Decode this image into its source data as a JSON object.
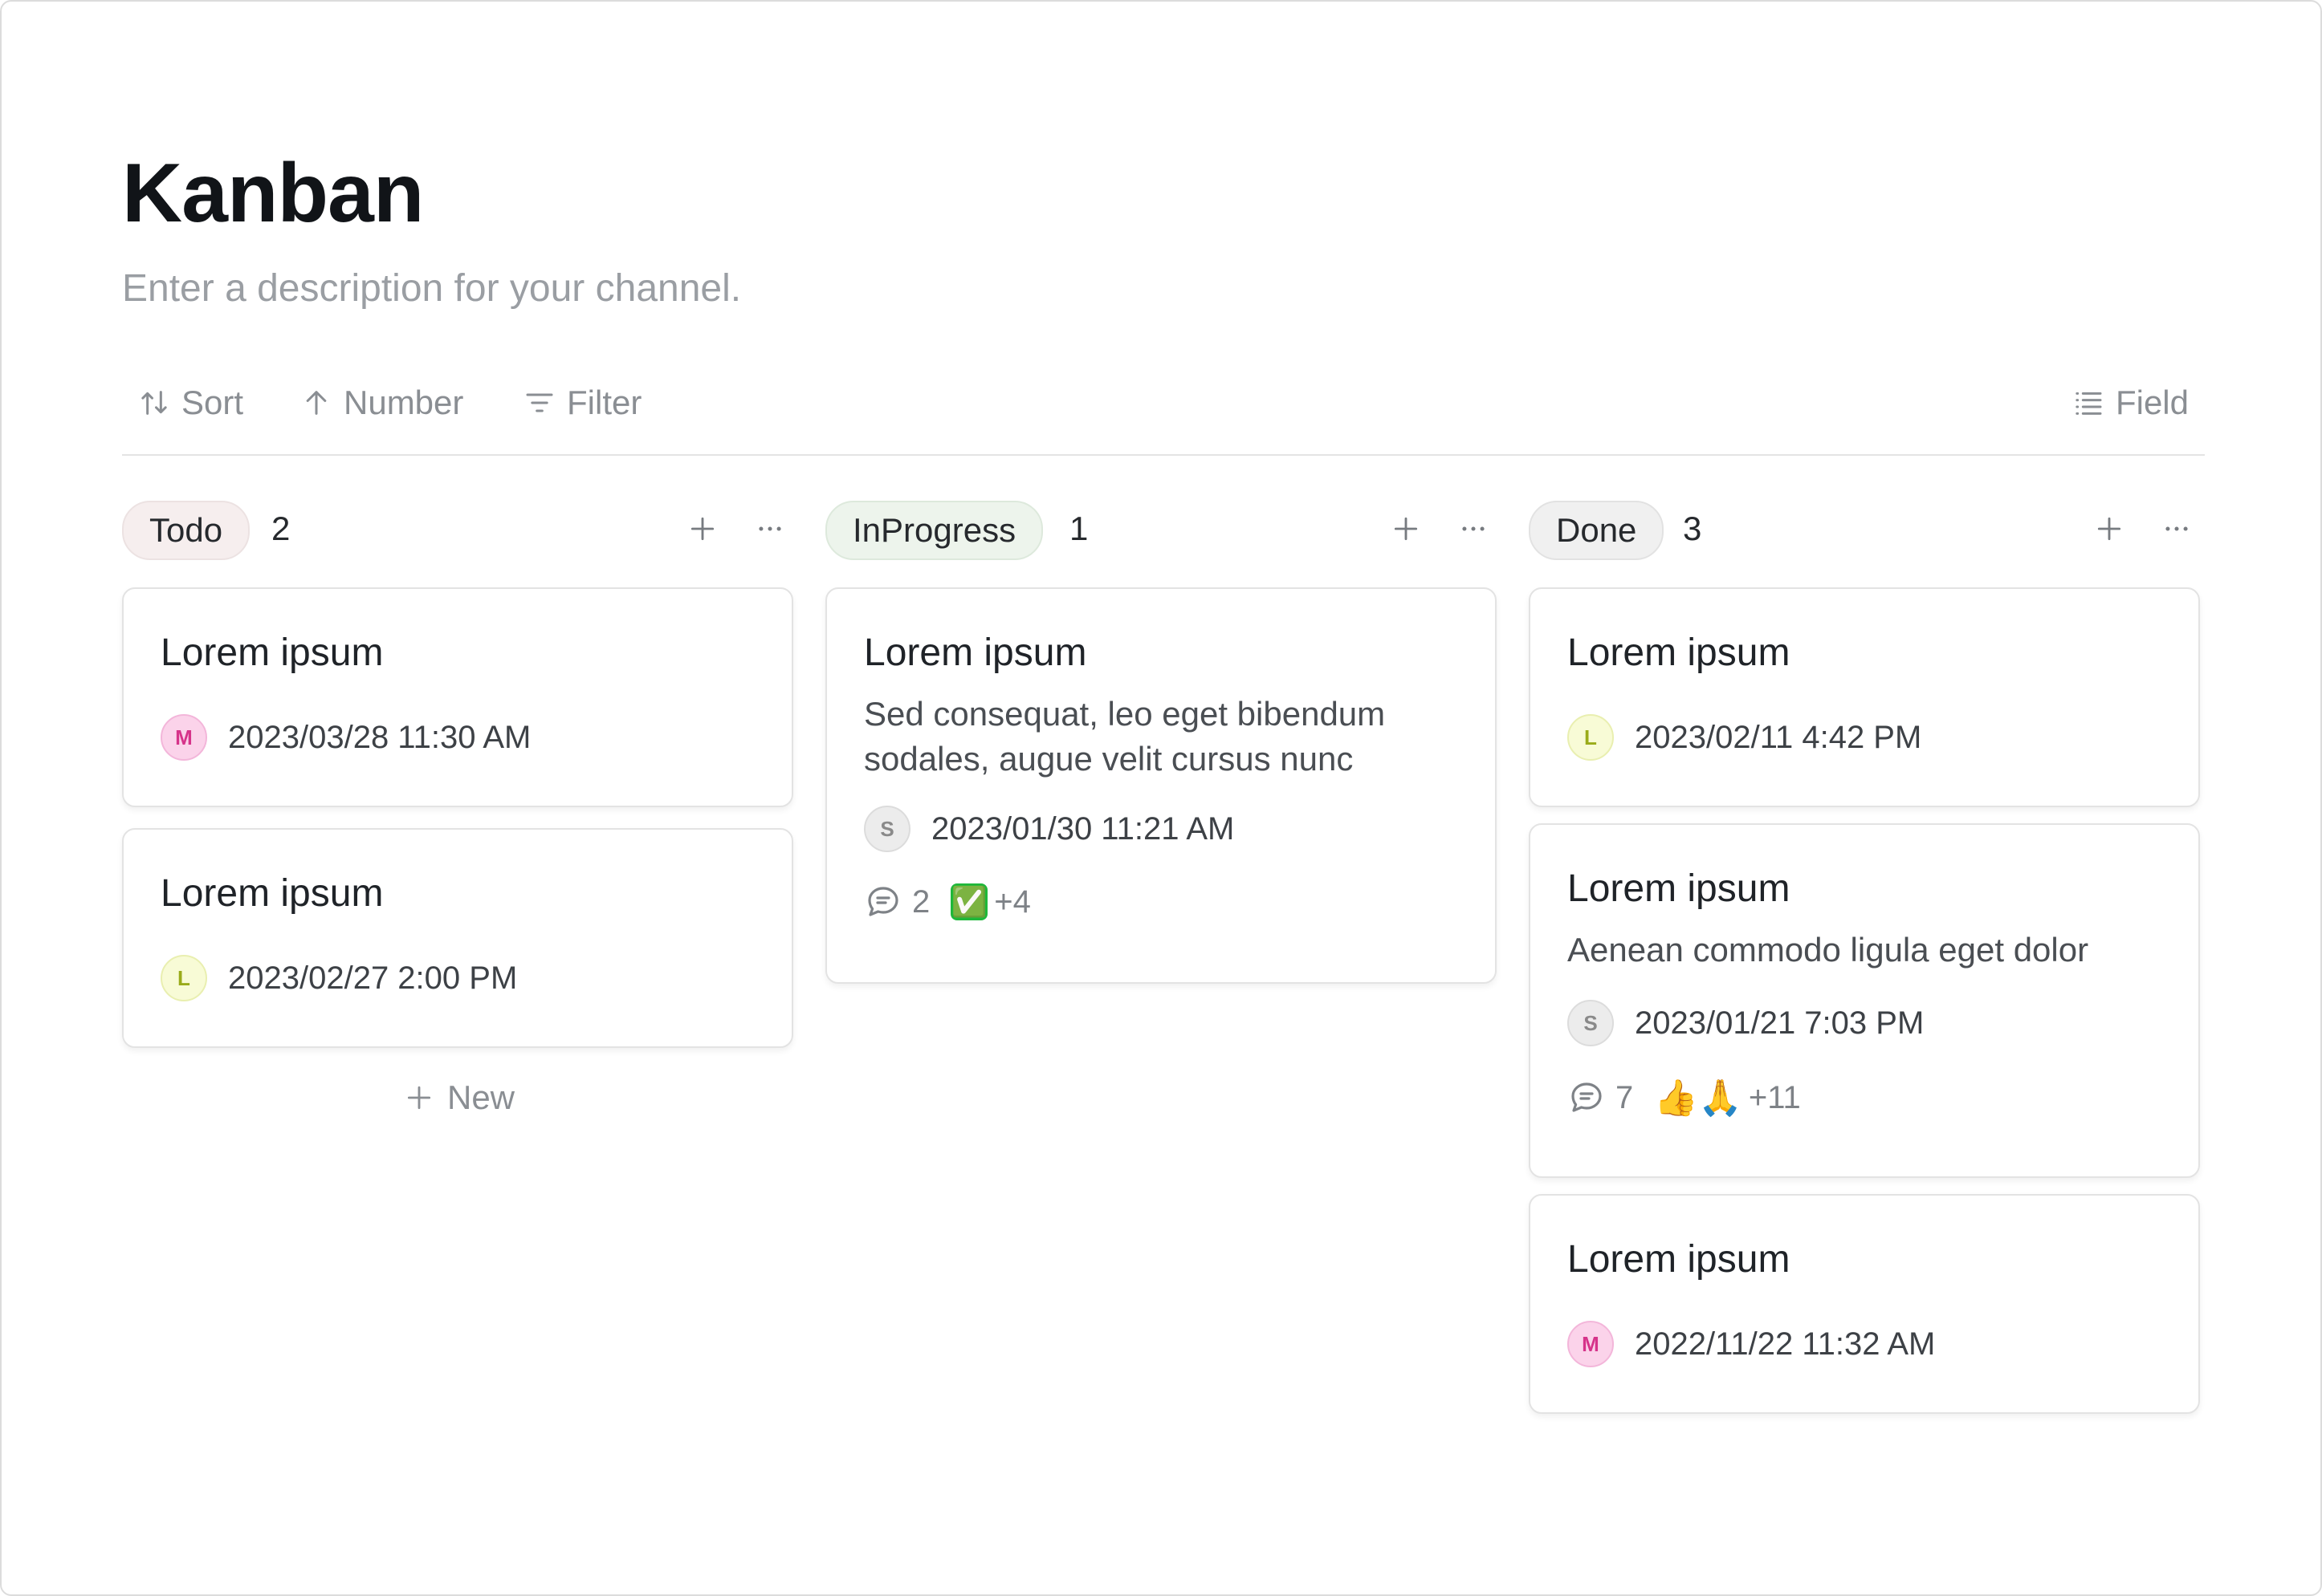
{
  "page": {
    "title": "Kanban",
    "description": "Enter a description for your channel."
  },
  "toolbar": {
    "sort_label": "Sort",
    "number_label": "Number",
    "filter_label": "Filter",
    "field_label": "Field"
  },
  "columns": [
    {
      "name": "Todo",
      "count": "2",
      "new_label": "New",
      "cards": [
        {
          "title": "Lorem ipsum",
          "avatar": "M",
          "date": "2023/03/28 11:30 AM"
        },
        {
          "title": "Lorem ipsum",
          "avatar": "L",
          "date": "2023/02/27 2:00 PM"
        }
      ]
    },
    {
      "name": "InProgress",
      "count": "1",
      "cards": [
        {
          "title": "Lorem ipsum",
          "description": "Sed consequat, leo eget bibendum sodales, augue velit cursus nunc",
          "avatar": "S",
          "date": "2023/01/30 11:21 AM",
          "comments": "2",
          "reactions": "✅",
          "reaction_more": "+4"
        }
      ]
    },
    {
      "name": "Done",
      "count": "3",
      "cards": [
        {
          "title": "Lorem ipsum",
          "avatar": "L",
          "date": "2023/02/11 4:42 PM"
        },
        {
          "title": "Lorem ipsum",
          "description": "Aenean commodo ligula eget dolor",
          "avatar": "S",
          "date": "2023/01/21 7:03 PM",
          "comments": "7",
          "reactions": "👍🙏",
          "reaction_more": "+11"
        },
        {
          "title": "Lorem ipsum",
          "avatar": "M",
          "date": "2022/11/22 11:32 AM"
        }
      ]
    }
  ],
  "icons": {
    "sort": "sort-icon",
    "number": "arrow-up-icon",
    "filter": "filter-icon",
    "field": "list-icon",
    "add": "plus-icon",
    "more": "more-horizontal-icon",
    "comment": "comment-icon"
  },
  "colors": {
    "todo_pill": "#f6eeee",
    "inprogress_pill": "#edf4ec",
    "done_pill": "#f0f0f0",
    "avatar_M": "#fbd3ea",
    "avatar_L": "#f8fbd6",
    "avatar_S": "#ececec"
  }
}
